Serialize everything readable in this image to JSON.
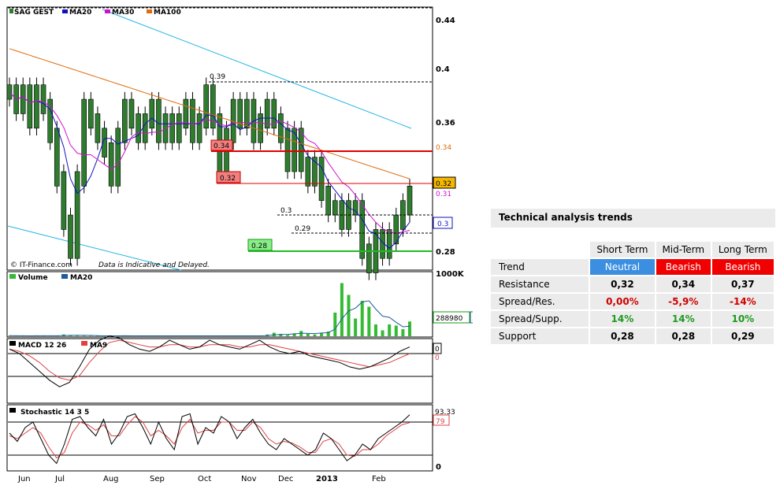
{
  "colors": {
    "candle": "#2e7d2e",
    "ma20": "#1010c0",
    "ma30": "#d010d0",
    "ma100": "#e06b0a",
    "channel": "#22b5e5",
    "resistance": "#e00000",
    "support": "#22bb22",
    "volume": "#33bb33",
    "macd": "#000000",
    "macd_signal": "#e04040",
    "stoch_k": "#000000",
    "stoch_d": "#e04040"
  },
  "main_chart": {
    "legend": {
      "symbol": "SAG GEST",
      "ma20": "MA20",
      "ma30": "MA30",
      "ma100": "MA100"
    },
    "copyright": "© IT-Finance.com",
    "disclaimer": "Data is Indicative and Delayed.",
    "y_ticks": [
      "0.44",
      "0.4",
      "0.36",
      "0.32",
      "0.28"
    ],
    "annotations": {
      "r1": "0.39",
      "r2": "0.34",
      "r3": "0.32",
      "s1": "0.3",
      "s2": "0.29",
      "s3": "0.28"
    },
    "right_tags": {
      "ma100": "0.34",
      "last": "0.32",
      "ma30": "0.31",
      "ma20": "0.3"
    }
  },
  "chart_data": [
    {
      "type": "candlestick",
      "title": "SAG GEST",
      "series_names": [
        "MA20",
        "MA30",
        "MA100"
      ],
      "x_labels": [
        "Jun",
        "Jul",
        "Aug",
        "Sep",
        "Oct",
        "Nov",
        "Dec",
        "2013",
        "Feb"
      ],
      "ylim": [
        0.275,
        0.45
      ],
      "y_ticks": [
        0.44,
        0.4,
        0.36,
        0.32,
        0.28
      ],
      "close": [
        0.39,
        0.38,
        0.39,
        0.37,
        0.39,
        0.38,
        0.36,
        0.33,
        0.3,
        0.28,
        0.33,
        0.38,
        0.37,
        0.36,
        0.35,
        0.33,
        0.36,
        0.38,
        0.37,
        0.36,
        0.37,
        0.38,
        0.36,
        0.37,
        0.36,
        0.37,
        0.38,
        0.36,
        0.37,
        0.39,
        0.37,
        0.34,
        0.36,
        0.38,
        0.37,
        0.38,
        0.36,
        0.37,
        0.38,
        0.37,
        0.36,
        0.34,
        0.36,
        0.34,
        0.33,
        0.34,
        0.32,
        0.31,
        0.31,
        0.3,
        0.31,
        0.31,
        0.28,
        0.27,
        0.29,
        0.28,
        0.29,
        0.3,
        0.31,
        0.32
      ],
      "last_value": 0.32
    },
    {
      "type": "bar",
      "title": "Volume",
      "series_names": [
        "Volume",
        "MA20"
      ],
      "last_value": 288980,
      "y_max_label": "1000K",
      "values": [
        10,
        5,
        8,
        6,
        12,
        7,
        5,
        9,
        30,
        20,
        8,
        6,
        5,
        10,
        7,
        6,
        8,
        9,
        5,
        6,
        7,
        8,
        6,
        5,
        9,
        7,
        6,
        8,
        5,
        6,
        7,
        9,
        8,
        6,
        5,
        7,
        6,
        8,
        30,
        60,
        40,
        20,
        50,
        90,
        40,
        30,
        60,
        80,
        400,
        900,
        700,
        300,
        600,
        500,
        200,
        100,
        200,
        180,
        120,
        250
      ]
    },
    {
      "type": "line",
      "title": "MACD 12 26",
      "series_names": [
        "MACD",
        "MA9"
      ],
      "last_value": 0,
      "macd": [
        0.002,
        0.0,
        -0.004,
        -0.008,
        -0.012,
        -0.015,
        -0.013,
        -0.006,
        0.002,
        0.006,
        0.008,
        0.007,
        0.004,
        0.002,
        0.001,
        0.003,
        0.006,
        0.004,
        0.002,
        0.003,
        0.006,
        0.004,
        0.003,
        0.002,
        0.004,
        0.006,
        0.003,
        0.001,
        0.0,
        0.001,
        -0.001,
        -0.002,
        -0.003,
        -0.004,
        -0.006,
        -0.007,
        -0.006,
        -0.004,
        -0.002,
        0.001,
        0.003
      ],
      "signal": [
        0.002,
        0.001,
        -0.001,
        -0.004,
        -0.008,
        -0.011,
        -0.012,
        -0.01,
        -0.004,
        0.001,
        0.005,
        0.006,
        0.005,
        0.004,
        0.003,
        0.003,
        0.004,
        0.004,
        0.003,
        0.003,
        0.004,
        0.004,
        0.004,
        0.003,
        0.003,
        0.004,
        0.004,
        0.003,
        0.002,
        0.001,
        0.0,
        -0.001,
        -0.002,
        -0.003,
        -0.004,
        -0.005,
        -0.006,
        -0.005,
        -0.004,
        -0.002,
        0.0
      ]
    },
    {
      "type": "line",
      "title": "Stochastic 14 3 5",
      "series_names": [
        "K",
        "D"
      ],
      "last_k": 93.33,
      "last_d": 79,
      "levels": [
        80,
        20
      ],
      "k": [
        60,
        45,
        70,
        80,
        50,
        20,
        5,
        40,
        85,
        90,
        70,
        55,
        85,
        40,
        60,
        90,
        95,
        70,
        40,
        80,
        50,
        30,
        90,
        95,
        40,
        70,
        60,
        90,
        80,
        50,
        70,
        85,
        60,
        40,
        30,
        50,
        40,
        30,
        20,
        30,
        60,
        50,
        30,
        10,
        20,
        40,
        30,
        50,
        60,
        70,
        80,
        93.33
      ],
      "d": [
        55,
        50,
        60,
        70,
        60,
        35,
        15,
        25,
        60,
        80,
        75,
        65,
        75,
        55,
        55,
        75,
        90,
        80,
        55,
        65,
        55,
        40,
        70,
        85,
        60,
        65,
        65,
        80,
        80,
        65,
        65,
        80,
        70,
        50,
        40,
        45,
        42,
        35,
        25,
        25,
        45,
        50,
        40,
        20,
        18,
        30,
        30,
        40,
        55,
        65,
        75,
        79
      ]
    }
  ],
  "volume_panel": {
    "title": "Volume",
    "ma": "MA20",
    "ymax": "1000K",
    "tag": "288980",
    "tag_suffix": "3"
  },
  "macd_panel": {
    "title": "MACD 12 26",
    "ma": "MA9",
    "tag_top": "0",
    "tag_bot": "0"
  },
  "stoch_panel": {
    "title": "Stochastic 14 3 5",
    "tag_k": "93.33",
    "tag_d": "79",
    "y_min": "0"
  },
  "x_axis": [
    "Jun",
    "Jul",
    "Aug",
    "Sep",
    "Oct",
    "Nov",
    "Dec",
    "2013",
    "Feb"
  ],
  "trends": {
    "title": "Technical analysis trends",
    "headers": [
      "Short Term",
      "Mid-Term",
      "Long Term"
    ],
    "rows": [
      {
        "label": "Trend",
        "values": [
          "Neutral",
          "Bearish",
          "Bearish"
        ]
      },
      {
        "label": "Resistance",
        "values": [
          "0,32",
          "0,34",
          "0,37"
        ]
      },
      {
        "label": "Spread/Res.",
        "values": [
          "0,00%",
          "-5,9%",
          "-14%"
        ]
      },
      {
        "label": "Spread/Supp.",
        "values": [
          "14%",
          "14%",
          "10%"
        ]
      },
      {
        "label": "Support",
        "values": [
          "0,28",
          "0,28",
          "0,29"
        ]
      }
    ]
  }
}
